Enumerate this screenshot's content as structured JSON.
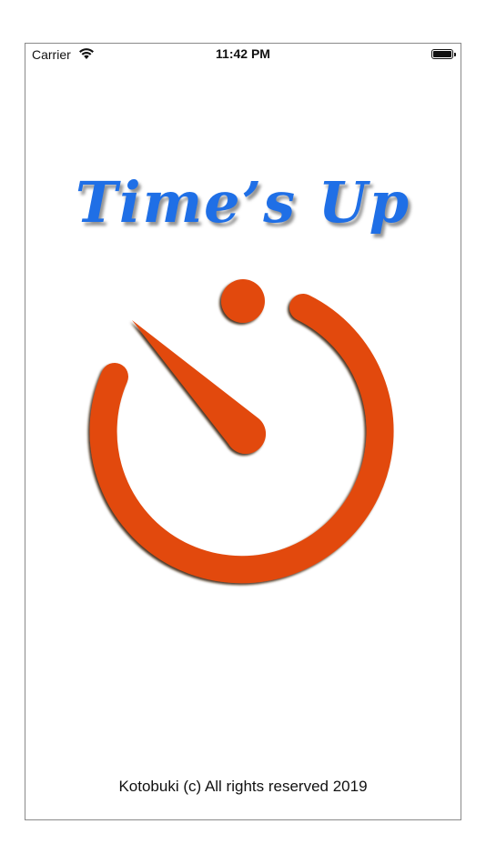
{
  "status_bar": {
    "carrier": "Carrier",
    "time": "11:42 PM",
    "wifi_icon": "wifi-icon",
    "battery_icon": "battery-icon"
  },
  "splash": {
    "title": "Time’s Up",
    "title_color": "#1f6fe6",
    "logo_icon": "stopwatch-icon",
    "logo_color": "#e24a0c",
    "footer": "Kotobuki (c) All rights reserved 2019"
  }
}
